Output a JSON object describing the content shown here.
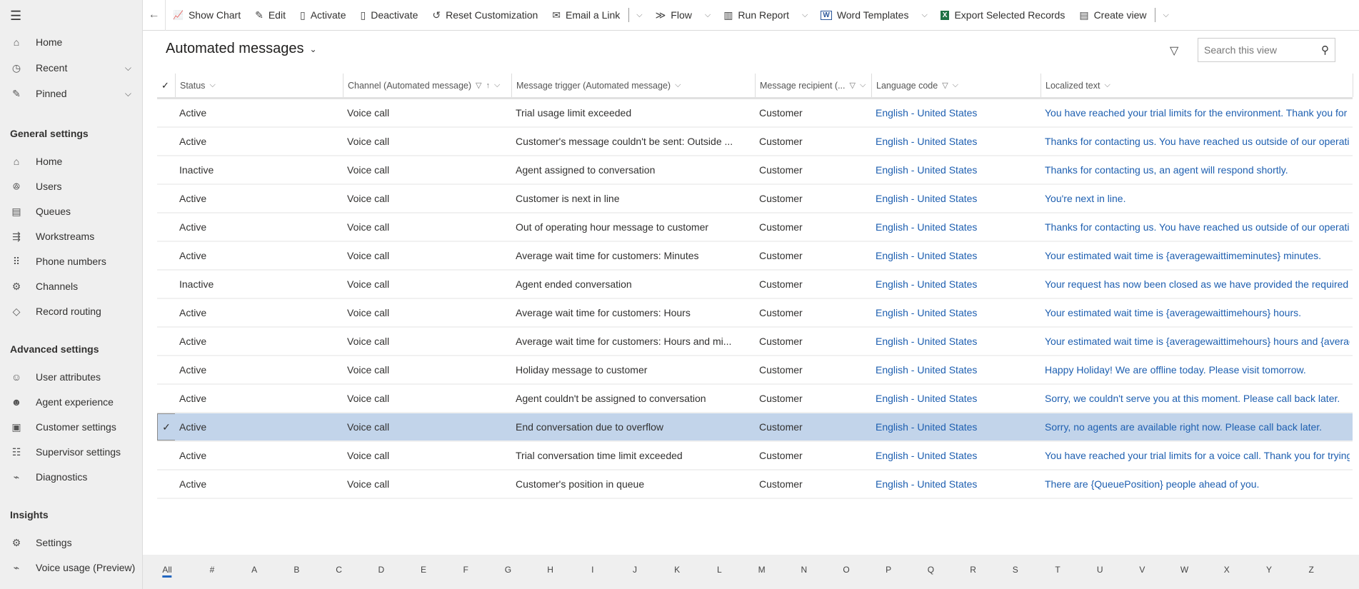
{
  "sidebar": {
    "top": [
      {
        "label": "Home",
        "icon": "home-icon",
        "glyph": "⌂"
      },
      {
        "label": "Recent",
        "icon": "clock-icon",
        "glyph": "◷",
        "chev": true
      },
      {
        "label": "Pinned",
        "icon": "pin-icon",
        "glyph": "✎",
        "chev": true
      }
    ],
    "sections": [
      {
        "title": "General settings",
        "items": [
          {
            "label": "Home",
            "icon": "home-icon",
            "glyph": "⌂"
          },
          {
            "label": "Users",
            "icon": "users-icon",
            "glyph": "ꔮ"
          },
          {
            "label": "Queues",
            "icon": "queues-icon",
            "glyph": "▤"
          },
          {
            "label": "Workstreams",
            "icon": "workstreams-icon",
            "glyph": "⇶"
          },
          {
            "label": "Phone numbers",
            "icon": "dialpad-icon",
            "glyph": "⠿"
          },
          {
            "label": "Channels",
            "icon": "gear-icon",
            "glyph": "⚙"
          },
          {
            "label": "Record routing",
            "icon": "routing-icon",
            "glyph": "◇"
          }
        ]
      },
      {
        "title": "Advanced settings",
        "items": [
          {
            "label": "User attributes",
            "icon": "user-attributes-icon",
            "glyph": "☺"
          },
          {
            "label": "Agent experience",
            "icon": "agent-icon",
            "glyph": "☻"
          },
          {
            "label": "Customer settings",
            "icon": "customer-icon",
            "glyph": "▣"
          },
          {
            "label": "Supervisor settings",
            "icon": "supervisor-icon",
            "glyph": "☷"
          },
          {
            "label": "Diagnostics",
            "icon": "diagnostics-icon",
            "glyph": "⌁"
          }
        ]
      },
      {
        "title": "Insights",
        "items": [
          {
            "label": "Settings",
            "icon": "gear-icon",
            "glyph": "⚙"
          },
          {
            "label": "Voice usage (Preview)",
            "icon": "chart-icon",
            "glyph": "⌁"
          }
        ]
      }
    ]
  },
  "toolbar": [
    {
      "label": "Show Chart",
      "icon": "chart-icon",
      "glyph": "📈"
    },
    {
      "label": "Edit",
      "icon": "pencil-icon",
      "glyph": "✎"
    },
    {
      "label": "Activate",
      "icon": "document-icon",
      "glyph": "▯"
    },
    {
      "label": "Deactivate",
      "icon": "document-blocked-icon",
      "glyph": "▯"
    },
    {
      "label": "Reset Customization",
      "icon": "reset-icon",
      "glyph": "↺"
    },
    {
      "label": "Email a Link",
      "icon": "email-icon",
      "glyph": "✉",
      "split": true
    },
    {
      "label": "Flow",
      "icon": "flow-icon",
      "glyph": "≫",
      "chev": true
    },
    {
      "label": "Run Report",
      "icon": "report-icon",
      "glyph": "▥",
      "chev": true
    },
    {
      "label": "Word Templates",
      "icon": "word-icon",
      "glyph": "W",
      "chev": true
    },
    {
      "label": "Export Selected Records",
      "icon": "excel-icon",
      "glyph": "X"
    },
    {
      "label": "Create view",
      "icon": "create-view-icon",
      "glyph": "▤",
      "split": true
    }
  ],
  "view": {
    "title": "Automated messages",
    "search_placeholder": "Search this view"
  },
  "columns": [
    "Status",
    "Channel (Automated message)",
    "Message trigger (Automated message)",
    "Message recipient (...",
    "Language code",
    "Localized text"
  ],
  "rows": [
    {
      "status": "Active",
      "channel": "Voice call",
      "trigger": "Trial usage limit exceeded",
      "recipient": "Customer",
      "language": "English - United States",
      "text": "You have reached your trial limits for the environment. Thank you for t"
    },
    {
      "status": "Active",
      "channel": "Voice call",
      "trigger": "Customer's message couldn't be sent: Outside ...",
      "recipient": "Customer",
      "language": "English - United States",
      "text": "Thanks for contacting us. You have reached us outside of our operatin"
    },
    {
      "status": "Inactive",
      "channel": "Voice call",
      "trigger": "Agent assigned to conversation",
      "recipient": "Customer",
      "language": "English - United States",
      "text": "Thanks for contacting us, an agent will respond shortly."
    },
    {
      "status": "Active",
      "channel": "Voice call",
      "trigger": "Customer is next in line",
      "recipient": "Customer",
      "language": "English - United States",
      "text": "You're next in line."
    },
    {
      "status": "Active",
      "channel": "Voice call",
      "trigger": "Out of operating hour message to customer",
      "recipient": "Customer",
      "language": "English - United States",
      "text": "Thanks for contacting us. You have reached us outside of our operatin"
    },
    {
      "status": "Active",
      "channel": "Voice call",
      "trigger": "Average wait time for customers: Minutes",
      "recipient": "Customer",
      "language": "English - United States",
      "text": "Your estimated wait time is {averagewaittimeminutes} minutes."
    },
    {
      "status": "Inactive",
      "channel": "Voice call",
      "trigger": "Agent ended conversation",
      "recipient": "Customer",
      "language": "English - United States",
      "text": "Your request has now been closed as we have provided the required i"
    },
    {
      "status": "Active",
      "channel": "Voice call",
      "trigger": "Average wait time for customers: Hours",
      "recipient": "Customer",
      "language": "English - United States",
      "text": "Your estimated wait time is {averagewaittimehours} hours."
    },
    {
      "status": "Active",
      "channel": "Voice call",
      "trigger": "Average wait time for customers: Hours and mi...",
      "recipient": "Customer",
      "language": "English - United States",
      "text": "Your estimated wait time is {averagewaittimehours} hours and {averag"
    },
    {
      "status": "Active",
      "channel": "Voice call",
      "trigger": "Holiday message to customer",
      "recipient": "Customer",
      "language": "English - United States",
      "text": "Happy Holiday! We are offline today. Please visit tomorrow."
    },
    {
      "status": "Active",
      "channel": "Voice call",
      "trigger": "Agent couldn't be assigned to conversation",
      "recipient": "Customer",
      "language": "English - United States",
      "text": "Sorry, we couldn't serve you at this moment. Please call back later."
    },
    {
      "status": "Active",
      "channel": "Voice call",
      "trigger": "End conversation due to overflow",
      "recipient": "Customer",
      "language": "English - United States",
      "text": "Sorry, no agents are available right now. Please call back later.",
      "selected": true
    },
    {
      "status": "Active",
      "channel": "Voice call",
      "trigger": "Trial conversation time limit exceeded",
      "recipient": "Customer",
      "language": "English - United States",
      "text": "You have reached your trial limits for a voice call. Thank you for trying"
    },
    {
      "status": "Active",
      "channel": "Voice call",
      "trigger": "Customer's position in queue",
      "recipient": "Customer",
      "language": "English - United States",
      "text": "There are {QueuePosition} people ahead of you."
    }
  ],
  "alphabet": [
    "All",
    "#",
    "A",
    "B",
    "C",
    "D",
    "E",
    "F",
    "G",
    "H",
    "I",
    "J",
    "K",
    "L",
    "M",
    "N",
    "O",
    "P",
    "Q",
    "R",
    "S",
    "T",
    "U",
    "V",
    "W",
    "X",
    "Y",
    "Z"
  ],
  "colors": {
    "link": "#1e5fb0",
    "selected_row": "#c2d4ea",
    "excel": "#1e7145",
    "word": "#2b579a"
  }
}
